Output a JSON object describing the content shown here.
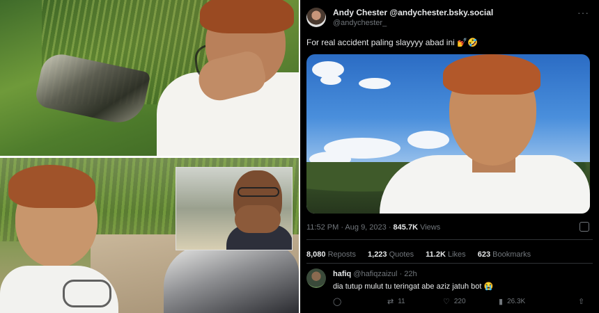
{
  "tweet": {
    "author_name": "Andy Chester",
    "author_bsky": "@andychester.bsky.social",
    "author_handle": "@andychester_",
    "more_icon": "more-dots-icon",
    "text": "For real accident paling slayyyy abad ini",
    "emojis": "💅🤣",
    "time": "11:52 PM · Aug 9, 2023",
    "views_count": "845.7K",
    "views_label": "Views",
    "stats": {
      "reposts_count": "8,080",
      "reposts_label": "Reposts",
      "quotes_count": "1,223",
      "quotes_label": "Quotes",
      "likes_count": "11.2K",
      "likes_label": "Likes",
      "bookmarks_count": "623",
      "bookmarks_label": "Bookmarks"
    },
    "reply": {
      "name": "hafiq",
      "handle": "@hafiqzaizul",
      "age": "22h",
      "text": "dia tutup mulut tu teringat abe aziz jatuh bot",
      "emoji": "😭",
      "retweets": "11",
      "likes": "220",
      "views": "26.3K"
    }
  },
  "colors": {
    "tweet_bg": "#000000",
    "text_primary": "#e7e9ea",
    "text_secondary": "#71767b",
    "separator": "#2f3336"
  }
}
